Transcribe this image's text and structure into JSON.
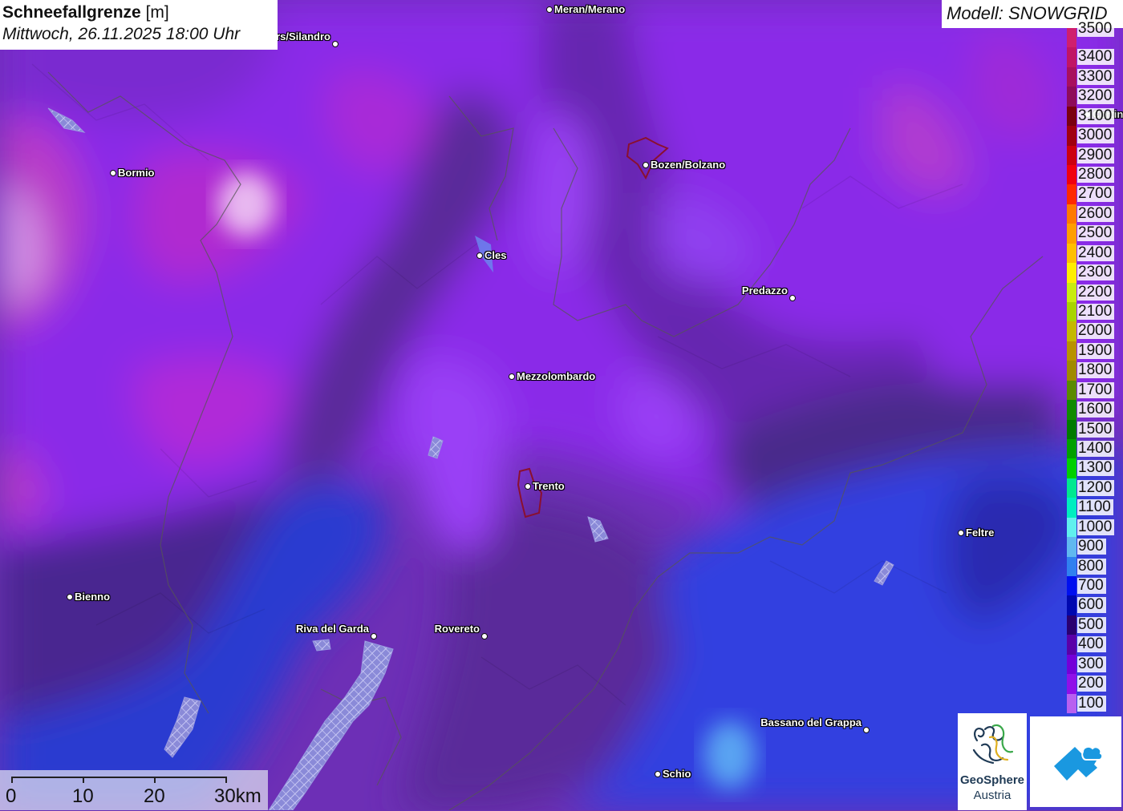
{
  "title": {
    "main": "Schneefallgrenze",
    "unit": "[m]",
    "datetime": "Mittwoch, 26.11.2025 18:00 Uhr"
  },
  "model": "Modell: SNOWGRID",
  "cities": [
    {
      "name": "Meran/Merano",
      "side": "r"
    },
    {
      "name": "Schlanders/Silandro",
      "side": "l"
    },
    {
      "name": "Bormio",
      "side": "r"
    },
    {
      "name": "Bozen/Bolzano",
      "side": "r"
    },
    {
      "name": "Cles",
      "side": "r"
    },
    {
      "name": "Predazzo",
      "side": "l"
    },
    {
      "name": "Mezzolombardo",
      "side": "r"
    },
    {
      "name": "Trento",
      "side": "r"
    },
    {
      "name": "Feltre",
      "side": "r"
    },
    {
      "name": "Bienno",
      "side": "r"
    },
    {
      "name": "Riva del Garda",
      "side": "l"
    },
    {
      "name": "Rovereto",
      "side": "l"
    },
    {
      "name": "Bassano del Grappa",
      "side": "l"
    },
    {
      "name": "Schio",
      "side": "r"
    },
    {
      "name": "Cortina",
      "side": "r"
    }
  ],
  "legend": {
    "unit": "m",
    "levels": [
      {
        "value": "3500",
        "color": "#cf1f6e"
      },
      {
        "value": "3400",
        "color": "#c01565"
      },
      {
        "value": "3300",
        "color": "#a8105e"
      },
      {
        "value": "3200",
        "color": "#8e0c5a"
      },
      {
        "value": "3100",
        "color": "#7a0010"
      },
      {
        "value": "3000",
        "color": "#a00010"
      },
      {
        "value": "2900",
        "color": "#cc0010"
      },
      {
        "value": "2800",
        "color": "#f00010"
      },
      {
        "value": "2700",
        "color": "#ff2a00"
      },
      {
        "value": "2600",
        "color": "#ff7a00"
      },
      {
        "value": "2500",
        "color": "#ff9e00"
      },
      {
        "value": "2400",
        "color": "#ffbf00"
      },
      {
        "value": "2300",
        "color": "#ffee00"
      },
      {
        "value": "2200",
        "color": "#c8ec10"
      },
      {
        "value": "2100",
        "color": "#a8d400"
      },
      {
        "value": "2000",
        "color": "#c4b800"
      },
      {
        "value": "1900",
        "color": "#b89200"
      },
      {
        "value": "1800",
        "color": "#a08a00"
      },
      {
        "value": "1700",
        "color": "#5a8a00"
      },
      {
        "value": "1600",
        "color": "#108a00"
      },
      {
        "value": "1500",
        "color": "#007a00"
      },
      {
        "value": "1400",
        "color": "#00a000"
      },
      {
        "value": "1300",
        "color": "#00d000"
      },
      {
        "value": "1200",
        "color": "#00e890"
      },
      {
        "value": "1100",
        "color": "#00eec0"
      },
      {
        "value": "1000",
        "color": "#60f0ee"
      },
      {
        "value": "900",
        "color": "#60b8f0"
      },
      {
        "value": "800",
        "color": "#3080f0"
      },
      {
        "value": "700",
        "color": "#0010f0"
      },
      {
        "value": "600",
        "color": "#0008b0"
      },
      {
        "value": "500",
        "color": "#2a0070"
      },
      {
        "value": "400",
        "color": "#5a00a8"
      },
      {
        "value": "300",
        "color": "#7400d8"
      },
      {
        "value": "200",
        "color": "#9010e8"
      },
      {
        "value": "100",
        "color": "#b860f0"
      }
    ]
  },
  "scale": {
    "labels": [
      "0",
      "10",
      "20",
      "30km"
    ]
  },
  "logo": {
    "name_line1": "GeoSphere",
    "name_line2": "Austria"
  }
}
